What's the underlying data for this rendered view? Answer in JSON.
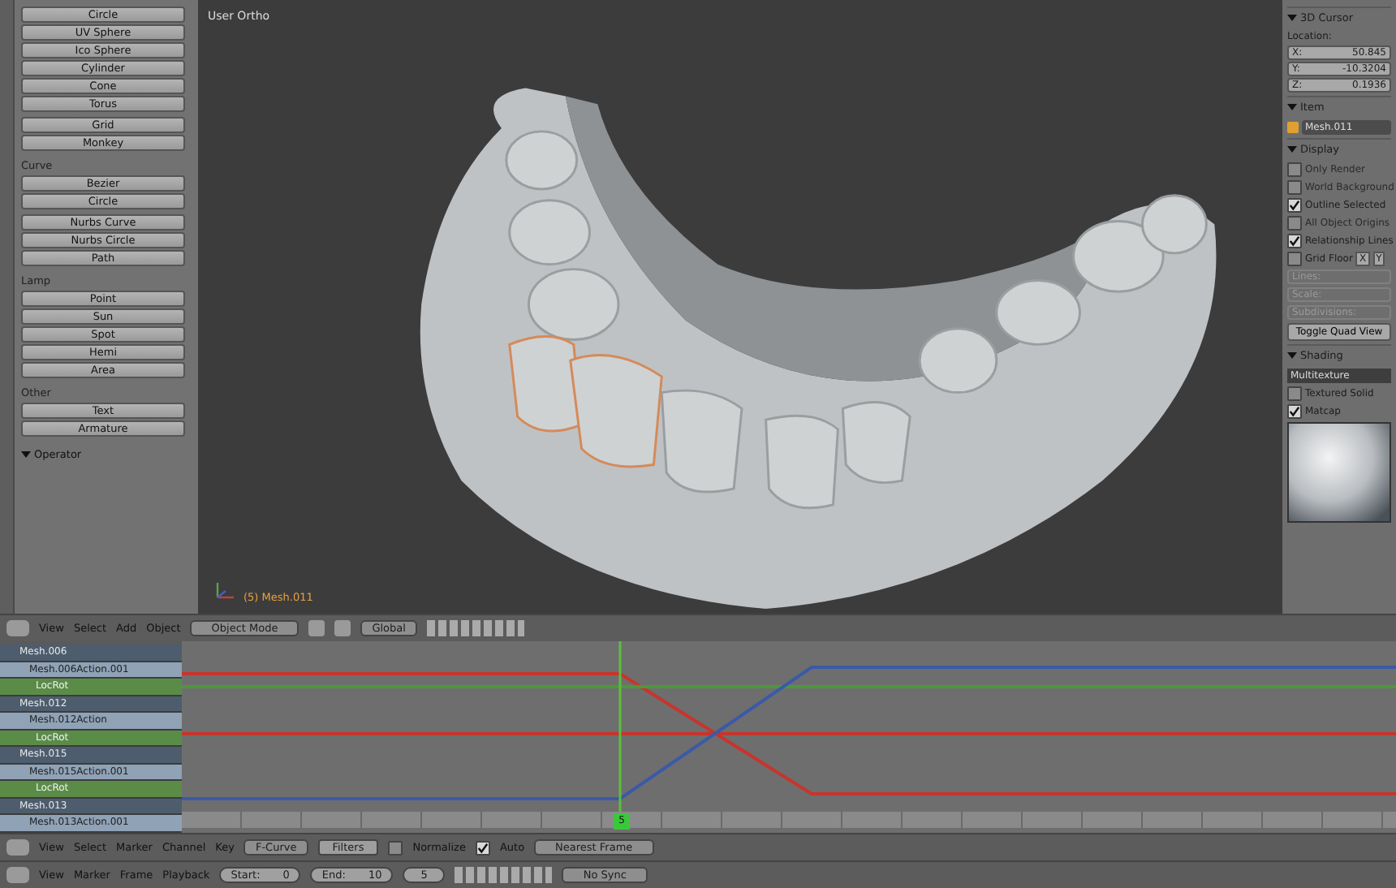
{
  "tool_panel": {
    "sections": [
      {
        "buttons": [
          "Circle",
          "UV Sphere",
          "Ico Sphere",
          "Cylinder",
          "Cone",
          "Torus"
        ]
      },
      {
        "buttons": [
          "Grid",
          "Monkey"
        ]
      },
      {
        "heading": "Curve",
        "buttons": [
          "Bezier",
          "Circle"
        ]
      },
      {
        "buttons": [
          "Nurbs Curve",
          "Nurbs Circle",
          "Path"
        ]
      },
      {
        "heading": "Lamp",
        "buttons": [
          "Point",
          "Sun",
          "Spot",
          "Hemi",
          "Area"
        ]
      },
      {
        "heading": "Other",
        "buttons": [
          "Text",
          "Armature"
        ]
      }
    ],
    "operator": "Operator"
  },
  "viewport": {
    "view_name": "User Ortho",
    "object_label": "(5) Mesh.011"
  },
  "properties": {
    "cursor_title": "3D Cursor",
    "location_label": "Location:",
    "coords": [
      {
        "axis": "X:",
        "value": "50.845"
      },
      {
        "axis": "Y:",
        "value": "-10.3204"
      },
      {
        "axis": "Z:",
        "value": "0.1936"
      }
    ],
    "item_title": "Item",
    "item_name": "Mesh.011",
    "display_title": "Display",
    "display_options": [
      {
        "label": "Only Render",
        "checked": false
      },
      {
        "label": "World Background",
        "checked": false
      },
      {
        "label": "Outline Selected",
        "checked": true
      },
      {
        "label": "All Object Origins",
        "checked": false
      },
      {
        "label": "Relationship Lines",
        "checked": true
      }
    ],
    "grid_floor": {
      "label": "Grid Floor",
      "checked": false,
      "x": "X",
      "y": "Y"
    },
    "grid_fields": [
      "Lines:",
      "Scale:",
      "Subdivisions:"
    ],
    "quad_view": "Toggle Quad View",
    "shading_title": "Shading",
    "shading_mode": "Multitexture",
    "shading_options": [
      {
        "label": "Textured Solid",
        "checked": false
      },
      {
        "label": "Matcap",
        "checked": true
      }
    ]
  },
  "viewport_header": {
    "menus": [
      "View",
      "Select",
      "Add",
      "Object"
    ],
    "mode": "Object Mode",
    "orientation": "Global"
  },
  "graph_editor": {
    "channels": [
      {
        "kind": "object",
        "label": "Mesh.006"
      },
      {
        "kind": "action",
        "label": "Mesh.006Action.001"
      },
      {
        "kind": "group",
        "label": "LocRot"
      },
      {
        "kind": "object",
        "label": "Mesh.012"
      },
      {
        "kind": "action",
        "label": "Mesh.012Action"
      },
      {
        "kind": "group",
        "label": "LocRot"
      },
      {
        "kind": "object",
        "label": "Mesh.015"
      },
      {
        "kind": "action",
        "label": "Mesh.015Action.001"
      },
      {
        "kind": "group",
        "label": "LocRot"
      },
      {
        "kind": "object",
        "label": "Mesh.013"
      },
      {
        "kind": "action",
        "label": "Mesh.013Action.001"
      }
    ],
    "current_frame": "5"
  },
  "graph_header": {
    "menus": [
      "View",
      "Select",
      "Marker",
      "Channel",
      "Key"
    ],
    "mode": "F-Curve",
    "filters": "Filters",
    "normalize": {
      "label": "Normalize",
      "checked": false
    },
    "auto": {
      "label": "Auto",
      "checked": true
    },
    "snap": "Nearest Frame"
  },
  "timeline_header": {
    "menus": [
      "View",
      "Marker",
      "Frame",
      "Playback"
    ],
    "start_label": "Start:",
    "start": "0",
    "end_label": "End:",
    "end": "10",
    "frame": "5",
    "sync": "No Sync"
  }
}
